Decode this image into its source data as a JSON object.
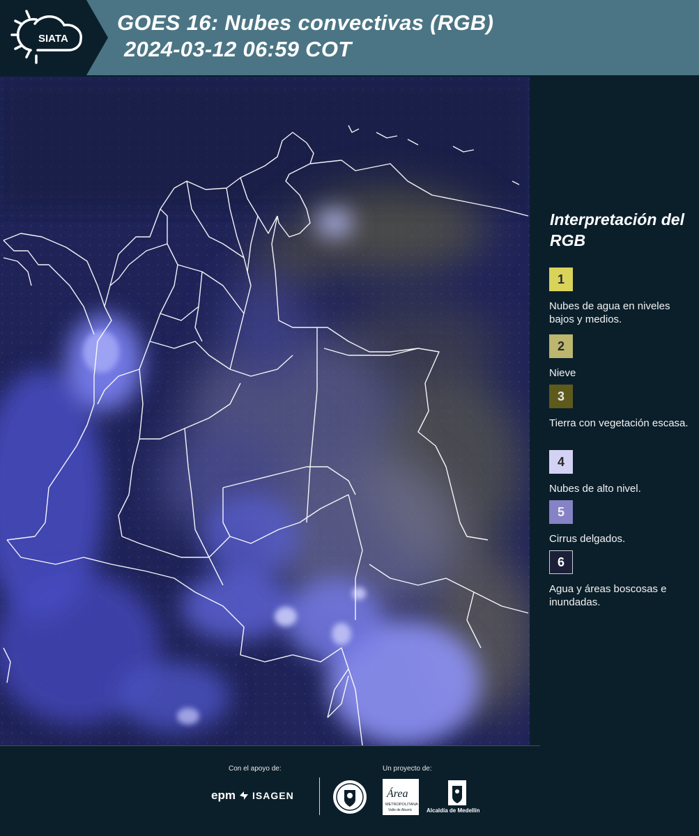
{
  "header": {
    "logo_text": "SIATA",
    "title_line1": "GOES 16: Nubes convectivas (RGB)",
    "title_line2": "2024-03-12 06:59 COT"
  },
  "legend": {
    "title": "Interpretación del RGB",
    "items": [
      {
        "number": "1",
        "label": "Nubes de agua en niveles bajos y medios.",
        "color": "#d9d35a"
      },
      {
        "number": "2",
        "label": "Nieve",
        "color": "#bcb66e"
      },
      {
        "number": "3",
        "label": "Tierra con vegetación escasa.",
        "color": "#5d5a1c"
      },
      {
        "number": "4",
        "label": "Nubes de alto nivel.",
        "color": "#d4d2f4"
      },
      {
        "number": "5",
        "label": "Cirrus delgados.",
        "color": "#8582c5"
      },
      {
        "number": "6",
        "label": "Agua y áreas boscosas e inundadas.",
        "color": "#1b1f38"
      }
    ]
  },
  "footer": {
    "support_label": "Con el apoyo de:",
    "project_label": "Un proyecto de:",
    "sponsors": [
      "epm",
      "ISAGEN"
    ],
    "partners": [
      "Medellín seal",
      "Área Metropolitana Valle de Aburrá",
      "Alcaldía de Medellín"
    ],
    "epm_text": "epm",
    "isagen_text": "ISAGEN",
    "alcaldia_text": "Alcaldía de Medellín",
    "area_text": "Área",
    "area_sub": "METROPOLITANA",
    "area_sub2": "Valle de Aburrá"
  },
  "colors": {
    "header_bg": "#4b7584",
    "panel_bg": "#0b1f2b",
    "map_base": "#1e2256",
    "cloud_blue": "#6a70e6",
    "boundary": "#ffffff"
  }
}
